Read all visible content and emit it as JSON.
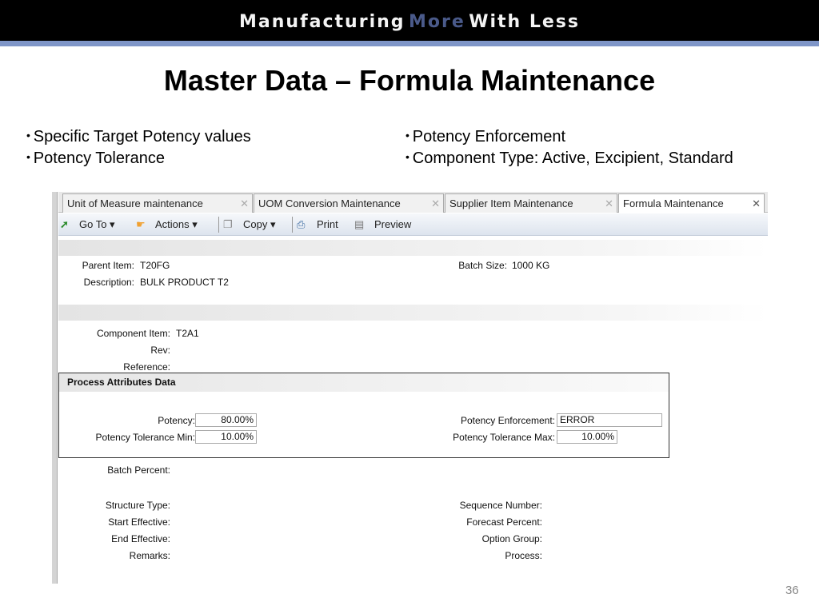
{
  "banner": {
    "part1": "Manufacturing",
    "part2": "More",
    "part3": "With Less"
  },
  "title": "Master Data – Formula Maintenance",
  "bullets_left": [
    "Specific Target Potency values",
    "Potency Tolerance"
  ],
  "bullets_right": [
    "Potency Enforcement",
    "Component Type: Active, Excipient, Standard"
  ],
  "tabs": [
    {
      "label": "Unit of Measure maintenance"
    },
    {
      "label": "UOM Conversion Maintenance"
    },
    {
      "label": "Supplier Item Maintenance"
    },
    {
      "label": "Formula Maintenance"
    }
  ],
  "toolbar": {
    "goto": "Go To ▾",
    "actions": "Actions ▾",
    "copy": "Copy ▾",
    "print": "Print",
    "preview": "Preview"
  },
  "header": {
    "parent_label": "Parent Item:",
    "parent_value": "T20FG",
    "desc_label": "Description:",
    "desc_value": "BULK PRODUCT T2",
    "batch_label": "Batch Size:",
    "batch_value": "1000 KG"
  },
  "component": {
    "item_label": "Component Item:",
    "item_value": "T2A1",
    "rev_label": "Rev:",
    "ref_label": "Reference:",
    "batch_pct_label": "Batch Percent:",
    "structure_label": "Structure Type:",
    "start_label": "Start Effective:",
    "end_label": "End Effective:",
    "remarks_label": "Remarks:",
    "seq_label": "Sequence Number:",
    "forecast_label": "Forecast Percent:",
    "option_label": "Option Group:",
    "process_label": "Process:"
  },
  "dialog": {
    "title": "Process Attributes Data",
    "potency_label": "Potency:",
    "potency_value": "80.00%",
    "tol_min_label": "Potency Tolerance Min:",
    "tol_min_value": "10.00%",
    "enforce_label": "Potency Enforcement:",
    "enforce_value": "ERROR",
    "tol_max_label": "Potency Tolerance Max:",
    "tol_max_value": "10.00%"
  },
  "page_number": "36"
}
